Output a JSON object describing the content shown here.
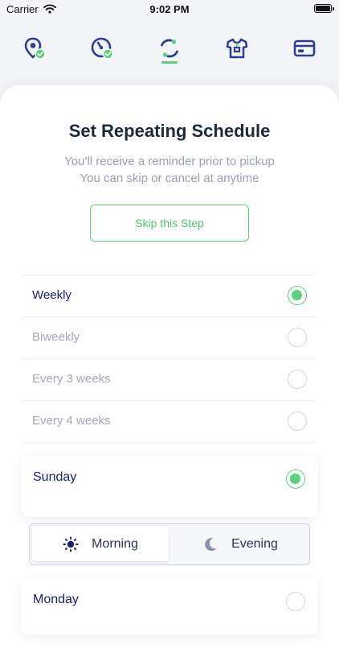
{
  "status_bar": {
    "carrier": "Carrier",
    "time": "9:02 PM"
  },
  "steps": [
    {
      "name": "location-check-icon",
      "state": "done"
    },
    {
      "name": "clock-check-icon",
      "state": "done"
    },
    {
      "name": "repeat-schedule-icon",
      "state": "active"
    },
    {
      "name": "tshirt-icon",
      "state": "pending"
    },
    {
      "name": "payment-card-icon",
      "state": "pending"
    }
  ],
  "header": {
    "title": "Set Repeating Schedule",
    "subtitle_line1": "You'll receive a reminder prior to pickup",
    "subtitle_line2": "You can skip or cancel at anytime",
    "skip_label": "Skip this Step"
  },
  "frequency": {
    "selected": "Weekly",
    "options": [
      "Weekly",
      "Biweekly",
      "Every 3 weeks",
      "Every 4 weeks"
    ]
  },
  "days": [
    {
      "label": "Sunday",
      "selected": true
    },
    {
      "label": "Monday",
      "selected": false
    }
  ],
  "time_of_day": {
    "selected": "Morning",
    "morning": "Morning",
    "evening": "Evening"
  },
  "colors": {
    "accent": "#5bd17a",
    "navy": "#1a1f6e",
    "muted": "#a3a9b5",
    "icon_blue": "#2c3f8c"
  }
}
